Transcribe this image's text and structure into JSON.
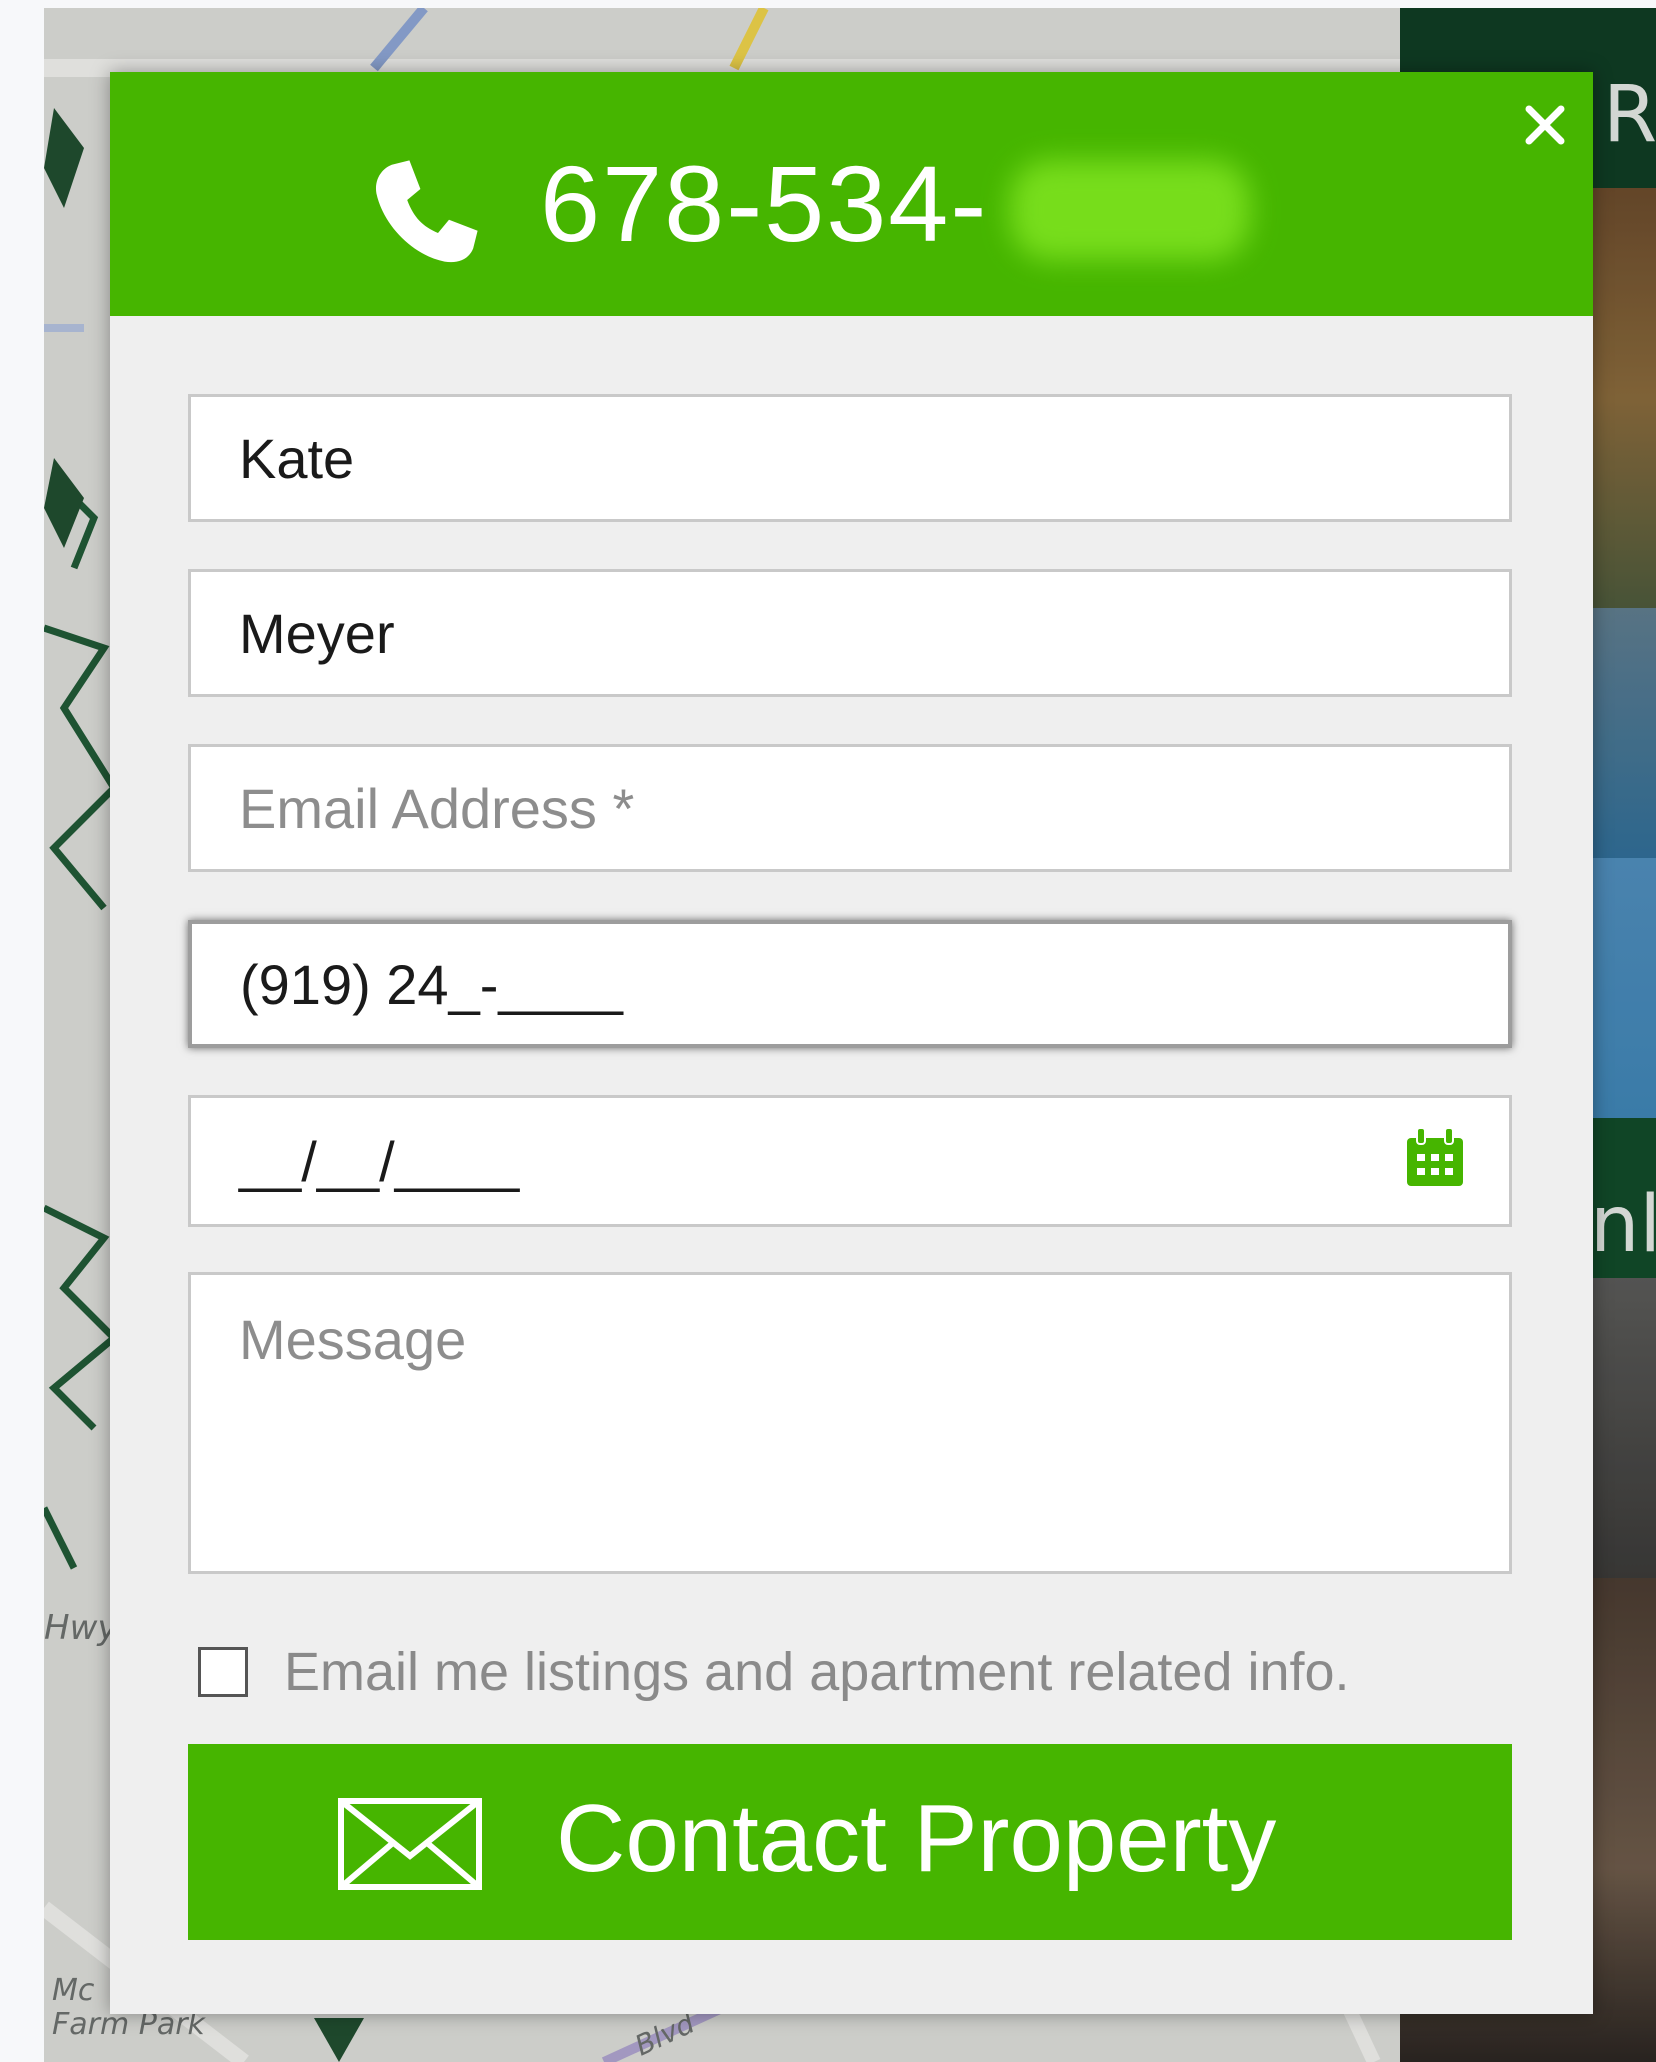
{
  "background": {
    "map_labels": {
      "hwy": "Hwy",
      "park": "Mc\nFarm Park",
      "blvd": "Blvd"
    },
    "right_edge_letters": [
      "R",
      "nl"
    ]
  },
  "modal": {
    "header": {
      "phone_visible": "678-534-",
      "accent_color": "#46b500"
    },
    "close_icon": "close-icon",
    "form": {
      "first_name_value": "Kate",
      "last_name_value": "Meyer",
      "email_placeholder": "Email Address *",
      "phone_value": "(919) 24_-____",
      "date_value": "__/__/____",
      "message_placeholder": "Message",
      "opt_in_label": "Email me listings and apartment related info.",
      "opt_in_checked": false
    },
    "submit": {
      "label": "Contact Property",
      "icon": "mail-icon"
    }
  }
}
